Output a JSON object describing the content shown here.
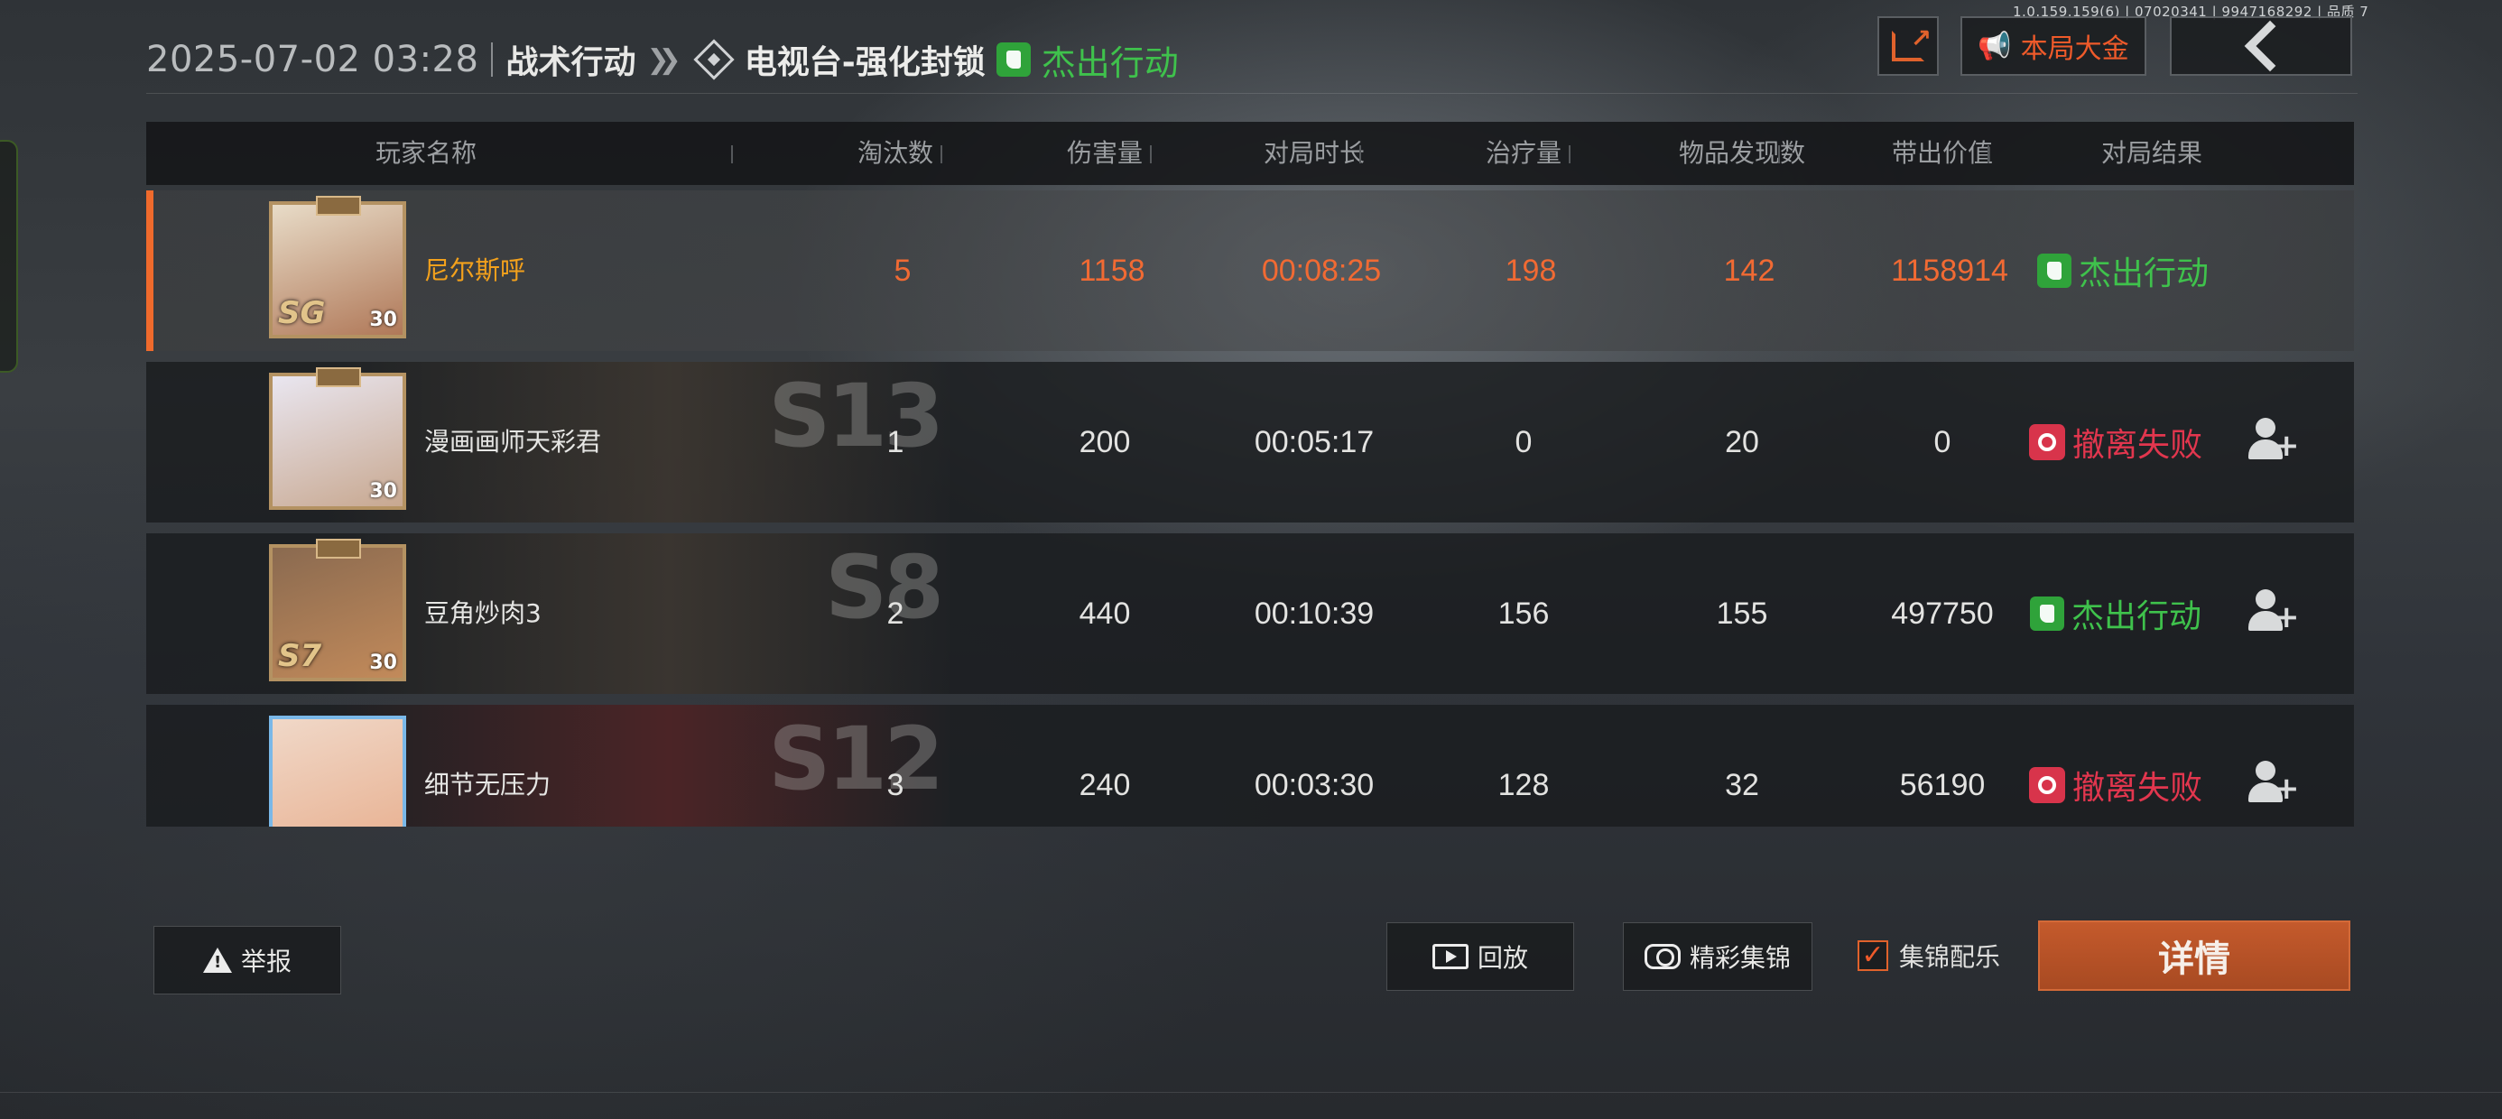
{
  "version_text": "1.0.159.159(6) | 07020341 | 9947168292 | 品质 7",
  "header": {
    "datetime": "2025-07-02 03:28",
    "mode": "战术行动",
    "map": "电视台-强化封锁",
    "result": "杰出行动",
    "result_color": "#3fc24c"
  },
  "top_buttons": {
    "share_icon": "share-icon",
    "jackpot_label": "本局大金",
    "back_icon": "chevron-left-icon"
  },
  "table": {
    "columns": [
      "玩家名称",
      "淘汰数",
      "伤害量",
      "对局时长",
      "治疗量",
      "物品发现数",
      "带出价值",
      "对局结果"
    ],
    "rows": [
      {
        "name": "尼尔斯呼",
        "avatar_tier": "SG",
        "level": "30",
        "season": "",
        "eliminations": "5",
        "damage": "1158",
        "duration": "00:08:25",
        "healing": "198",
        "items_found": "142",
        "extracted_value": "1158914",
        "result": "杰出行动",
        "result_type": "success",
        "self": true
      },
      {
        "name": "漫画画师天彩君",
        "avatar_tier": "",
        "level": "30",
        "season": "S13",
        "eliminations": "1",
        "damage": "200",
        "duration": "00:05:17",
        "healing": "0",
        "items_found": "20",
        "extracted_value": "0",
        "result": "撤离失败",
        "result_type": "fail",
        "self": false
      },
      {
        "name": "豆角炒肉3",
        "avatar_tier": "S7",
        "level": "30",
        "season": "S8",
        "eliminations": "2",
        "damage": "440",
        "duration": "00:10:39",
        "healing": "156",
        "items_found": "155",
        "extracted_value": "497750",
        "result": "杰出行动",
        "result_type": "success",
        "self": false
      },
      {
        "name": "细节无压力",
        "avatar_tier": "",
        "level": "",
        "season": "S12",
        "eliminations": "3",
        "damage": "240",
        "duration": "00:03:30",
        "healing": "128",
        "items_found": "32",
        "extracted_value": "56190",
        "result": "撤离失败",
        "result_type": "fail",
        "self": false
      }
    ]
  },
  "bottom": {
    "report_label": "举报",
    "replay_label": "回放",
    "highlights_label": "精彩集锦",
    "music_label": "集锦配乐",
    "music_checked": true,
    "detail_label": "详情"
  },
  "colors": {
    "accent_orange": "#ef6a2c",
    "success_green": "#3fc24c",
    "fail_red": "#e2364e",
    "self_name": "#f3a11c"
  }
}
